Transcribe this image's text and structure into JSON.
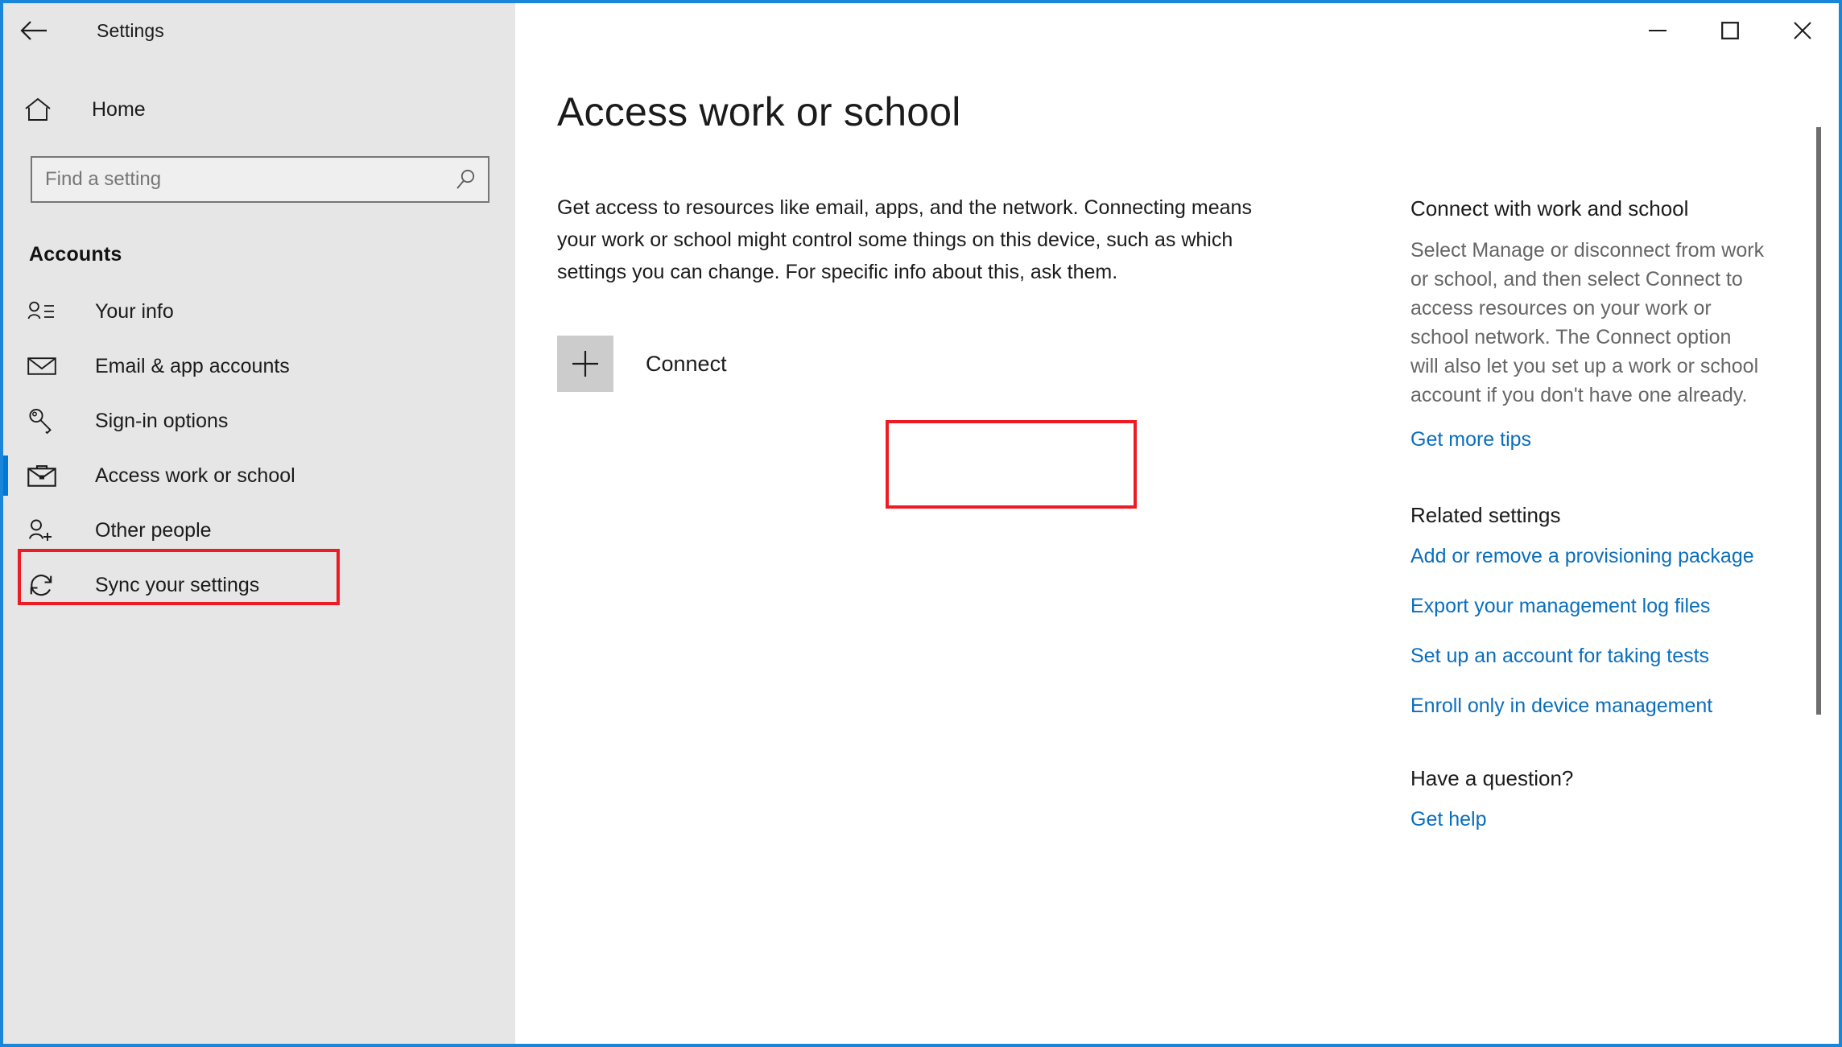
{
  "window": {
    "title": "Settings",
    "back_icon": "back-arrow-icon",
    "controls": {
      "minimize": "minimize-icon",
      "maximize": "maximize-icon",
      "close": "close-icon"
    },
    "border_color": "#1a86d9"
  },
  "sidebar": {
    "home_label": "Home",
    "home_icon": "home-icon",
    "search": {
      "placeholder": "Find a setting",
      "value": "",
      "icon": "search-icon"
    },
    "category": "Accounts",
    "accent_color": "#0078d7",
    "items": [
      {
        "label": "Your info",
        "icon": "person-info-icon",
        "selected": false
      },
      {
        "label": "Email & app accounts",
        "icon": "envelope-icon",
        "selected": false
      },
      {
        "label": "Sign-in options",
        "icon": "key-icon",
        "selected": false
      },
      {
        "label": "Access work or school",
        "icon": "briefcase-icon",
        "selected": true
      },
      {
        "label": "Other people",
        "icon": "person-add-icon",
        "selected": false
      },
      {
        "label": "Sync your settings",
        "icon": "sync-icon",
        "selected": false
      }
    ]
  },
  "main": {
    "page_title": "Access work or school",
    "intro": "Get access to resources like email, apps, and the network. Connecting means your work or school might control some things on this device, such as which settings you can change. For specific info about this, ask them.",
    "connect": {
      "label": "Connect",
      "icon": "plus-icon"
    }
  },
  "rail": {
    "connect_section": {
      "heading": "Connect with work and school",
      "body": "Select Manage or disconnect from work or school, and then select Connect to access resources on your work or school network. The Connect option will also let you set up a work or school account if you don't have one already.",
      "link": "Get more tips"
    },
    "related_section": {
      "heading": "Related settings",
      "links": [
        "Add or remove a provisioning package",
        "Export your management log files",
        "Set up an account for taking tests",
        "Enroll only in device management"
      ]
    },
    "question_section": {
      "heading": "Have a question?",
      "link": "Get help"
    },
    "link_color": "#0a6ebd"
  },
  "annotations": {
    "color": "#ed1c24",
    "targets": [
      "sidebar-item-access-work-or-school",
      "connect-button"
    ]
  }
}
